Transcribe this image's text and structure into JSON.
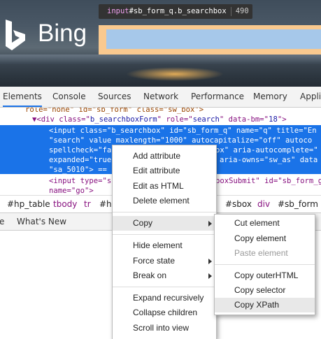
{
  "page": {
    "tooltip": {
      "tag": "input",
      "selector": "#sb_form_q.b_searchbox",
      "size": "490 × 30"
    },
    "logo_text": "Bing"
  },
  "devtools": {
    "tabs": [
      "Elements",
      "Console",
      "Sources",
      "Network",
      "Performance",
      "Memory",
      "Appli"
    ],
    "active_tab": "Elements",
    "dom_lines": {
      "l0": "role=\"none\" id=\"sb_form\" class=\"sw_box\">",
      "l1a": "▼<div class=\"",
      "l1b": "b_searchboxForm",
      "l1c": "\" role=\"",
      "l1d": "search",
      "l1e": "\" data-bm=\"",
      "l1f": "18",
      "l1g": "\">",
      "l2": "<input class=\"b_searchbox\" id=\"sb_form_q\" name=\"q\" title=\"En",
      "l3": "\"search\" value maxlength=\"1000\" autocapitalize=\"off\" autoco",
      "l4": "spellcheck=\"fa",
      "l4b": "ox\" aria-autocomplete=\"",
      "l5": "expanded=\"true",
      "l5b": "aria-owns=\"sw_as\" data",
      "l6": "\"sa_5010\"> == ",
      "l7a": "<input type=\"s",
      "l7b": "boxSubmit\" id=\"sb_form_g",
      "l8": "name=\"go\">"
    },
    "breadcrumbs": [
      "#hp_table",
      "tbody",
      "tr",
      "#h",
      "#sbox",
      "div",
      "#sb_form"
    ],
    "drawer_tabs": [
      "e",
      "What's New"
    ]
  },
  "context_menu": {
    "items": {
      "add_attribute": "Add attribute",
      "edit_attribute": "Edit attribute",
      "edit_as_html": "Edit as HTML",
      "delete_element": "Delete element",
      "copy": "Copy",
      "hide_element": "Hide element",
      "force_state": "Force state",
      "break_on": "Break on",
      "expand_recursively": "Expand recursively",
      "collapse_children": "Collapse children",
      "scroll_into_view": "Scroll into view"
    }
  },
  "copy_submenu": {
    "items": {
      "cut_element": "Cut element",
      "copy_element": "Copy element",
      "paste_element": "Paste element",
      "copy_outerhtml": "Copy outerHTML",
      "copy_selector": "Copy selector",
      "copy_xpath": "Copy XPath"
    }
  },
  "colors": {
    "selection": "#1a73e8",
    "tooltip_bg": "#333333",
    "margin_highlight": "#f9c98f",
    "content_highlight": "#a6c8ea"
  },
  "icons": [
    "bing-logo-icon",
    "submenu-arrow-icon"
  ]
}
